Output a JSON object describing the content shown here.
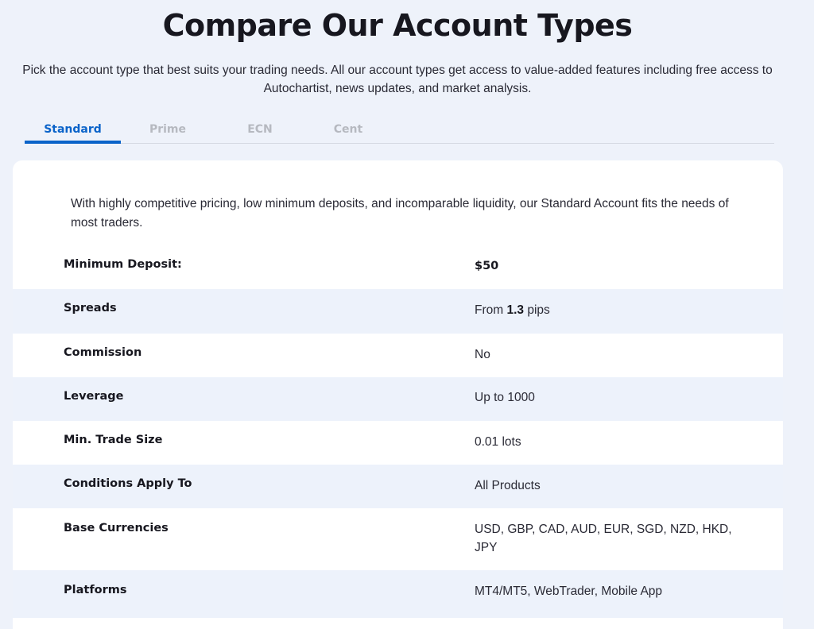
{
  "header": {
    "title": "Compare Our Account Types",
    "subtitle": "Pick the account type that best suits your trading needs. All our account types get access to value-added features including free access to Autochartist, news updates, and market analysis."
  },
  "tabs": [
    {
      "label": "Standard",
      "active": true
    },
    {
      "label": "Prime",
      "active": false
    },
    {
      "label": "ECN",
      "active": false
    },
    {
      "label": "Cent",
      "active": false
    }
  ],
  "account": {
    "intro": "With highly competitive pricing, low minimum deposits, and incomparable liquidity, our Standard Account fits the needs of most traders.",
    "specs": [
      {
        "label": "Minimum Deposit:",
        "value": "$50"
      },
      {
        "label": "Spreads",
        "value_prefix": "From ",
        "value_strong": "1.3",
        "value_suffix": " pips"
      },
      {
        "label": "Commission",
        "value": "No"
      },
      {
        "label": "Leverage",
        "value": "Up to 1000"
      },
      {
        "label": "Min. Trade Size",
        "value": "0.01 lots"
      },
      {
        "label": "Conditions Apply To",
        "value": "All Products"
      },
      {
        "label": "Base Currencies",
        "value": "USD, GBP, CAD, AUD, EUR, SGD, NZD, HKD, JPY"
      },
      {
        "label": "Platforms",
        "value": "MT4/MT5, WebTrader, Mobile App"
      }
    ]
  },
  "colors": {
    "accent": "#0a63c9",
    "page_background": "#eef2fa",
    "alt_row": "#edf2fb",
    "inactive_tab": "#b6b9c0"
  }
}
